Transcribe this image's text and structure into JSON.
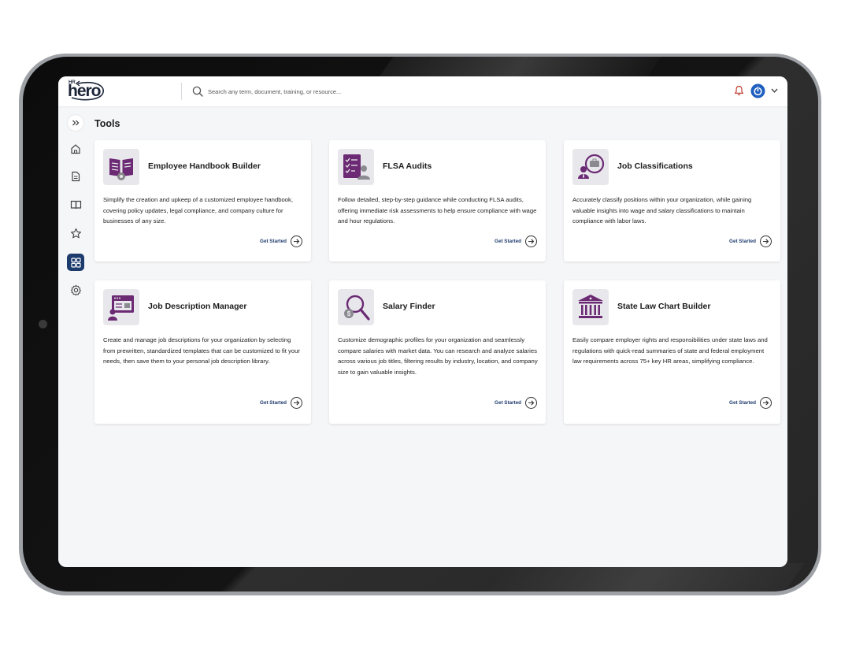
{
  "app": {
    "logo_hr": "HR",
    "logo_word": "hero"
  },
  "search": {
    "placeholder": "Search any term, document, training, or resource..."
  },
  "sidebar": {
    "items": [
      {
        "name": "expand",
        "icon": "double-chevron-right-icon"
      },
      {
        "name": "home",
        "icon": "home-icon"
      },
      {
        "name": "documents",
        "icon": "document-icon"
      },
      {
        "name": "library",
        "icon": "book-icon"
      },
      {
        "name": "favorites",
        "icon": "star-icon"
      },
      {
        "name": "tools",
        "icon": "grid-icon",
        "active": true
      },
      {
        "name": "settings",
        "icon": "gear-icon"
      }
    ]
  },
  "page": {
    "title": "Tools"
  },
  "cards": [
    {
      "title": "Employee Handbook Builder",
      "description": "Simplify the creation and upkeep of a customized employee handbook, covering policy updates, legal compliance, and company culture for businesses of any size.",
      "cta": "Get Started",
      "icon": "handbook-icon"
    },
    {
      "title": "FLSA Audits",
      "description": "Follow detailed, step-by-step guidance while conducting FLSA audits, offering immediate risk assessments to help ensure compliance with wage and hour regulations.",
      "cta": "Get Started",
      "icon": "checklist-icon"
    },
    {
      "title": "Job Classifications",
      "description": "Accurately classify positions within your organization, while gaining valuable insights into wage and salary classifications to maintain compliance with labor laws.",
      "cta": "Get Started",
      "icon": "job-classification-icon"
    },
    {
      "title": "Job Description Manager",
      "description": "Create and manage job descriptions for your organization by selecting from prewritten, standardized templates that can be customized to fit your needs, then save them to your personal job description library.",
      "cta": "Get Started",
      "icon": "job-description-icon"
    },
    {
      "title": "Salary Finder",
      "description": "Customize demographic profiles for your organization and seamlessly compare salaries with market data. You can research and analyze salaries across various job titles, filtering results by industry, location, and company size to gain valuable insights.",
      "cta": "Get Started",
      "icon": "salary-search-icon"
    },
    {
      "title": "State Law Chart Builder",
      "description": "Easily compare employer rights and responsibilities under state laws and regulations with quick-read summaries of state and federal employment law requirements across 75+ key HR areas, simplifying compliance.",
      "cta": "Get Started",
      "icon": "courthouse-icon"
    }
  ],
  "colors": {
    "accent_purple": "#6b2a73",
    "brand_navy": "#1e3b6e",
    "notification_red": "#c0392b",
    "power_blue": "#1f5fbf"
  }
}
